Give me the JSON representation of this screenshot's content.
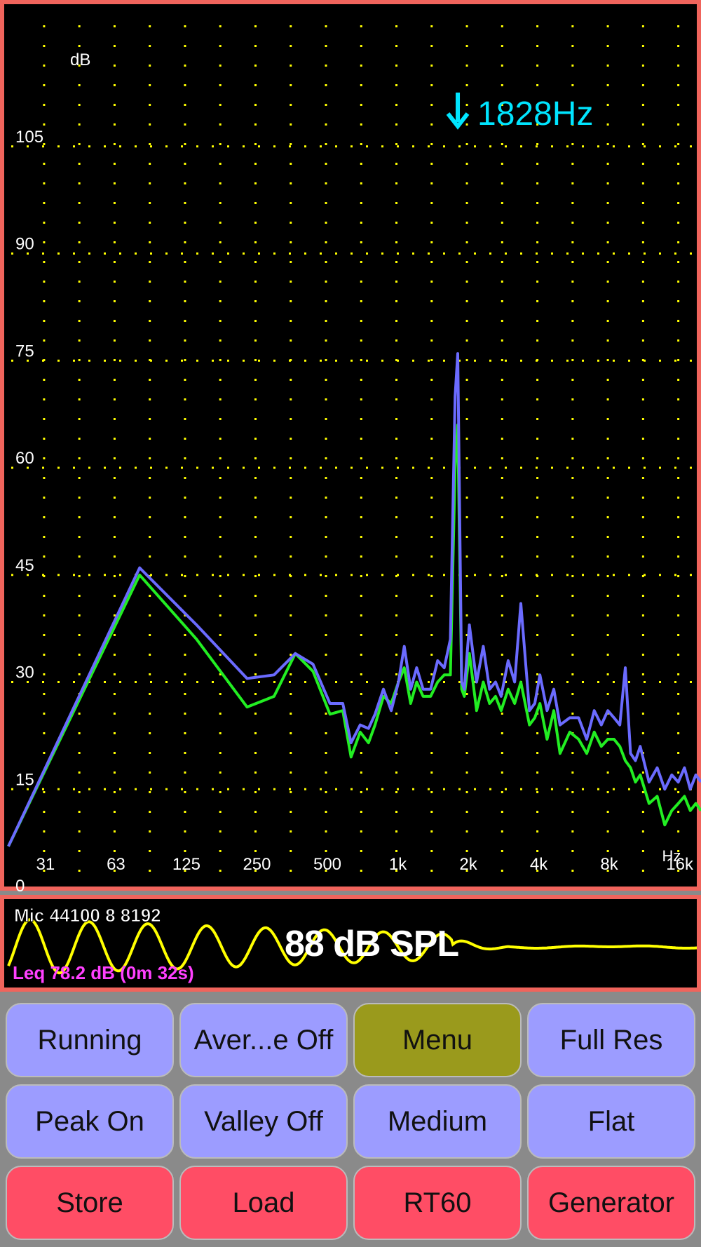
{
  "spectrum": {
    "y_unit": "dB",
    "x_unit": "Hz",
    "y_ticks": [
      "105",
      "90",
      "75",
      "60",
      "45",
      "30",
      "15",
      "0"
    ],
    "x_ticks": [
      "31",
      "63",
      "125",
      "250",
      "500",
      "1k",
      "2k",
      "4k",
      "8k",
      "16k"
    ],
    "peak_marker": "1828Hz",
    "colors": {
      "background": "#000000",
      "grid": "#ffff00",
      "peak_trace": "#6b6bff",
      "current_trace": "#22ee22",
      "marker": "#00e5ff",
      "frame": "#f0645c"
    }
  },
  "chart_data": {
    "type": "line",
    "xlabel": "Hz",
    "ylabel": "dB",
    "x_scale": "log",
    "xlim": [
      22,
      20000
    ],
    "ylim": [
      0,
      120
    ],
    "grid": true,
    "series": [
      {
        "color": "#6b6bff",
        "x": [
          22,
          80,
          140,
          230,
          300,
          370,
          440,
          520,
          590,
          640,
          700,
          760,
          810,
          880,
          950,
          1020,
          1080,
          1150,
          1220,
          1300,
          1400,
          1500,
          1600,
          1700,
          1780,
          1828,
          1900,
          1950,
          2050,
          2200,
          2350,
          2500,
          2650,
          2800,
          3000,
          3200,
          3400,
          3700,
          3900,
          4100,
          4400,
          4700,
          5000,
          5500,
          6000,
          6500,
          7000,
          7500,
          8000,
          8500,
          9000,
          9500,
          10000,
          10500,
          11000,
          12000,
          13000,
          14000,
          15000,
          16000,
          17000,
          18000,
          19000,
          20000
        ],
        "values": [
          7,
          46,
          38,
          30.5,
          31,
          34,
          32.5,
          27,
          27,
          21.5,
          24,
          23.5,
          25.5,
          29,
          26,
          30,
          35,
          29,
          32,
          29,
          29,
          33,
          32,
          36,
          70,
          76,
          30,
          29,
          38,
          30,
          35,
          29,
          30,
          28,
          33,
          30,
          41,
          26,
          27,
          31,
          26,
          29,
          24,
          25,
          25,
          22,
          26,
          24,
          26,
          25,
          24,
          32,
          20,
          19,
          21,
          16,
          18,
          15,
          17,
          16,
          18,
          15,
          17,
          16
        ]
      },
      {
        "color": "#22ee22",
        "x": [
          22,
          80,
          140,
          230,
          300,
          370,
          440,
          520,
          590,
          640,
          700,
          760,
          810,
          880,
          950,
          1020,
          1080,
          1150,
          1220,
          1300,
          1400,
          1500,
          1600,
          1700,
          1780,
          1828,
          1900,
          1950,
          2050,
          2200,
          2350,
          2500,
          2650,
          2800,
          3000,
          3200,
          3400,
          3700,
          3900,
          4100,
          4400,
          4700,
          5000,
          5500,
          6000,
          6500,
          7000,
          7500,
          8000,
          8500,
          9000,
          9500,
          10000,
          10500,
          11000,
          12000,
          13000,
          14000,
          15000,
          16000,
          17000,
          18000,
          19000,
          20000
        ],
        "values": [
          7,
          45,
          36,
          26.5,
          28,
          34,
          31.5,
          25.5,
          26,
          19.5,
          23,
          21.5,
          24,
          28,
          27,
          30,
          32,
          27,
          30,
          28,
          28,
          30,
          31,
          31,
          60,
          66,
          29,
          28,
          34,
          26,
          30,
          27,
          28,
          26,
          29,
          27,
          30,
          24,
          25,
          27,
          22,
          26,
          20,
          23,
          22,
          20,
          23,
          21,
          22,
          22,
          21,
          19,
          18,
          16,
          17,
          13,
          14,
          10,
          12,
          13,
          14,
          12,
          13,
          12
        ]
      }
    ]
  },
  "waveform": {
    "mic_info": "Mic 44100 8 8192",
    "spl_reading": "88 dB SPL",
    "leq": "Leq  78.2 dB (0m 32s)",
    "colors": {
      "waveform": "#ffff00",
      "leq": "#ff40ff"
    }
  },
  "buttons": {
    "running": "Running",
    "average": "Aver...e Off",
    "menu": "Menu",
    "full_res": "Full Res",
    "peak": "Peak On",
    "valley": "Valley Off",
    "medium": "Medium",
    "flat": "Flat",
    "store": "Store",
    "load": "Load",
    "rt60": "RT60",
    "generator": "Generator"
  }
}
